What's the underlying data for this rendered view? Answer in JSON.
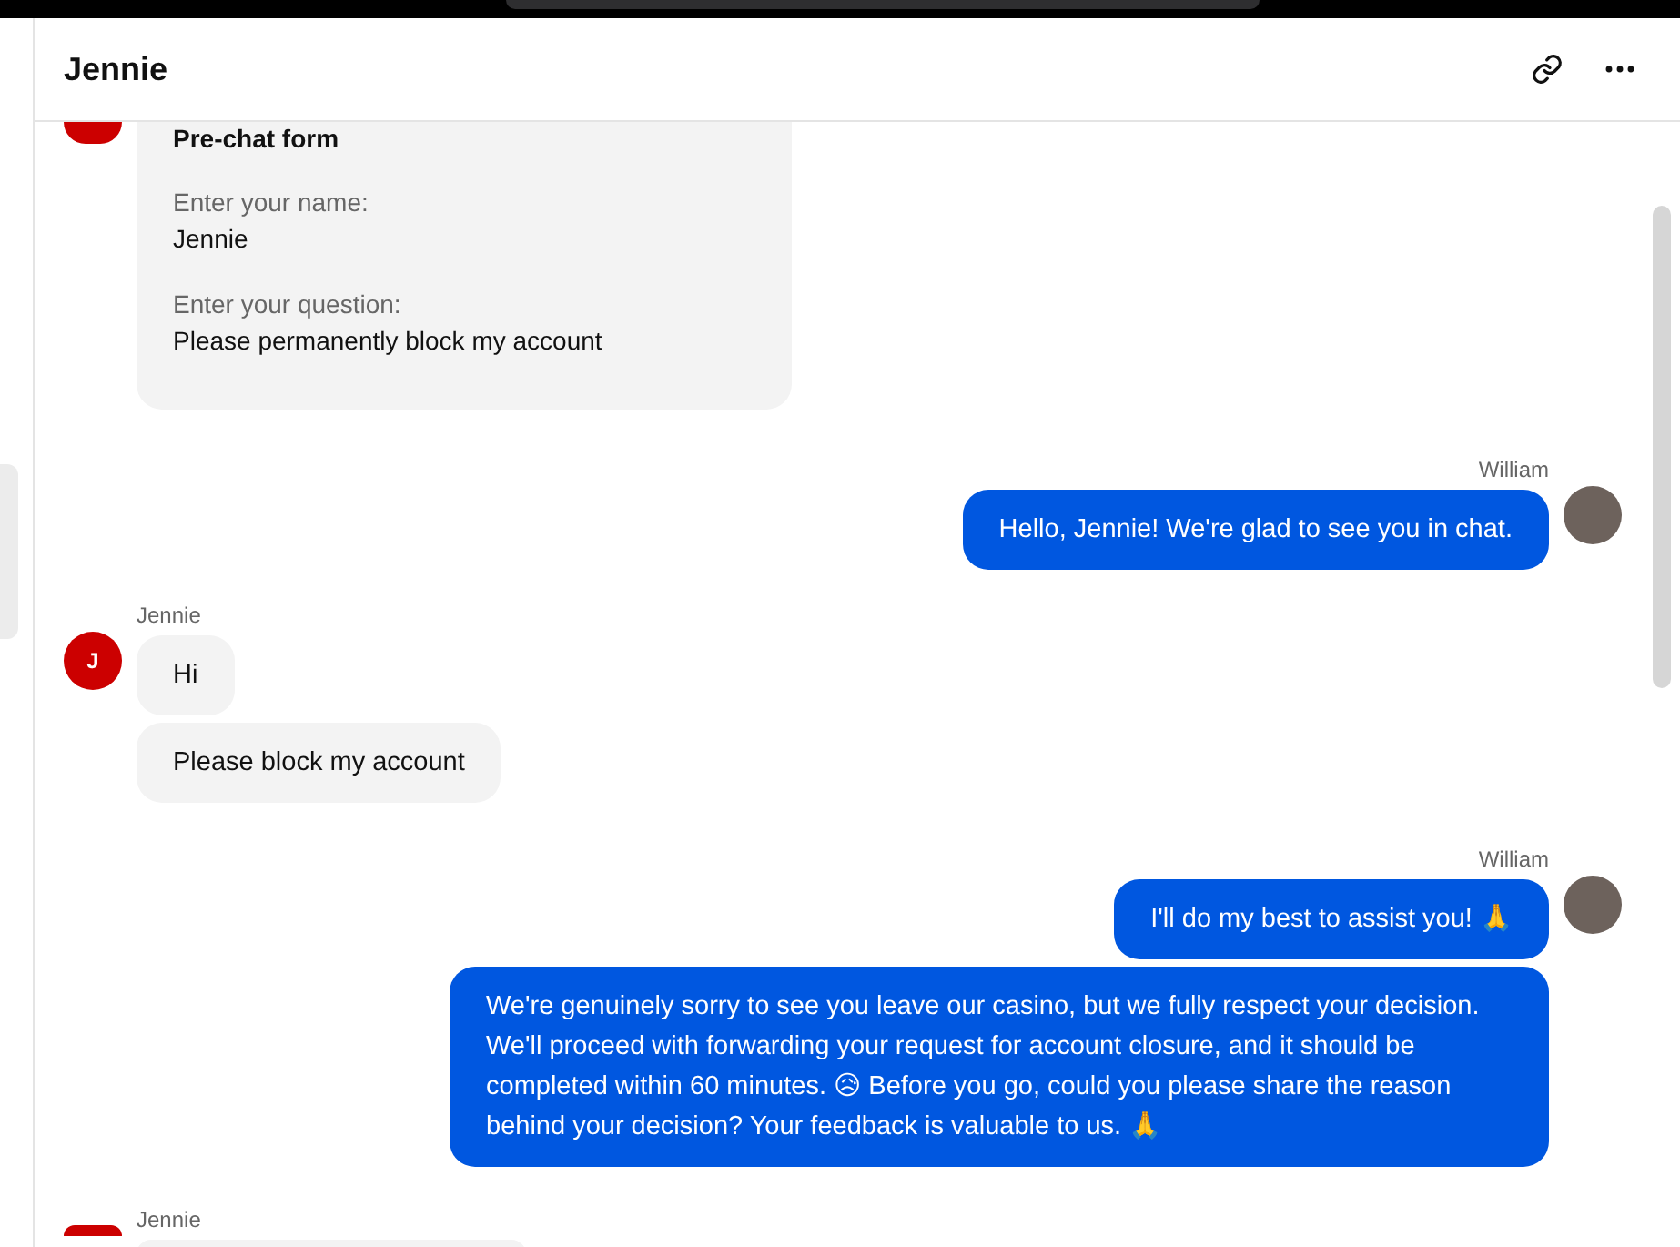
{
  "header": {
    "title": "Jennie"
  },
  "messages": [
    {
      "kind": "form",
      "outgoing": false,
      "title": "Pre-chat form",
      "fields": [
        {
          "label": "Enter your name:",
          "value": "Jennie"
        },
        {
          "label": "Enter your question:",
          "value": "Please permanently block my account"
        }
      ]
    },
    {
      "kind": "group",
      "outgoing": true,
      "author": "William",
      "bubbles": [
        "Hello, Jennie! We're glad to see you in chat."
      ]
    },
    {
      "kind": "group",
      "outgoing": false,
      "author": "Jennie",
      "avatar_letter": "J",
      "bubbles": [
        "Hi",
        "Please block my account"
      ]
    },
    {
      "kind": "group",
      "outgoing": true,
      "author": "William",
      "bubbles": [
        "I'll do my best to assist you! 🙏",
        "We're genuinely sorry to see you leave our casino, but we fully respect your decision. We'll proceed with forwarding your request for account closure, and it should be completed within 60 minutes. 😥 Before you go, could you please share the reason behind your decision? Your feedback is valuable to us. 🙏"
      ]
    },
    {
      "kind": "partial",
      "outgoing": false,
      "author": "Jennie"
    }
  ]
}
